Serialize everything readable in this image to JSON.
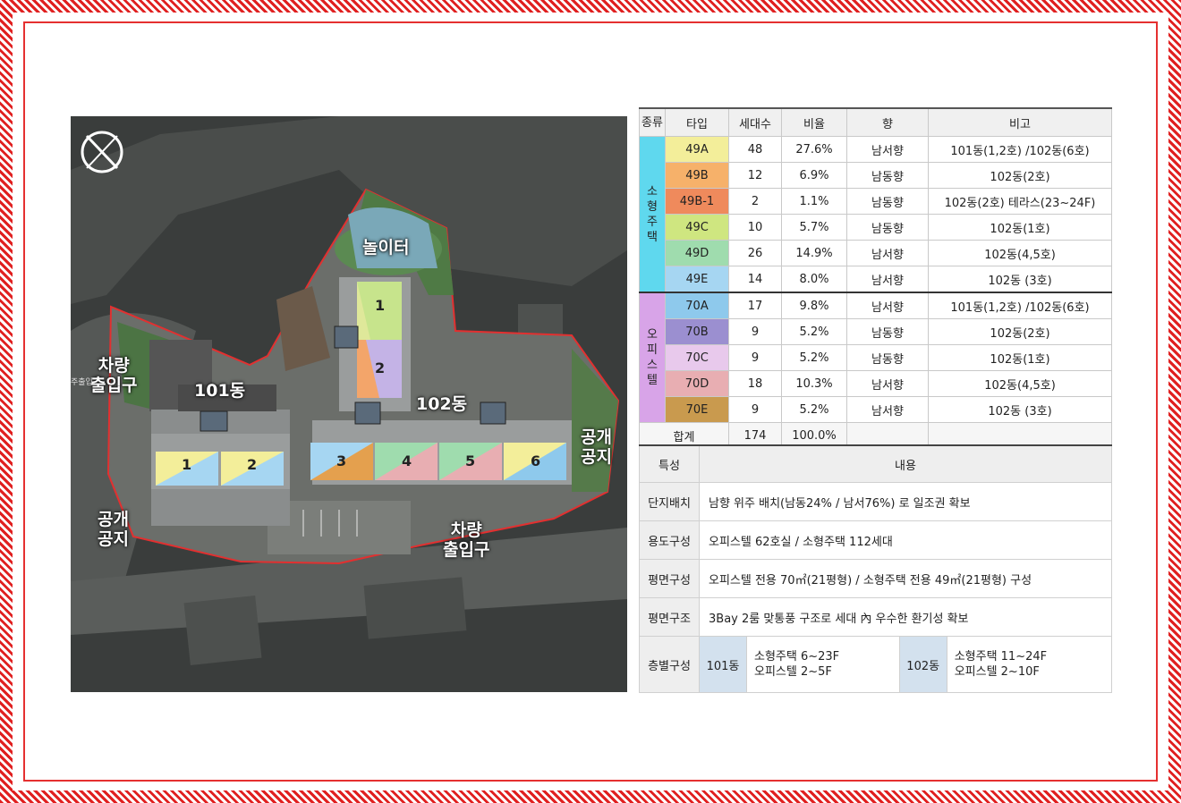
{
  "plan": {
    "labels": {
      "playground": "놀이터",
      "bldg101": "101동",
      "bldg102": "102동",
      "car_entrance_left": "차량\n출입구",
      "car_entrance_bottom": "차량\n출입구",
      "open_space_right": "공개\n공지",
      "open_space_left": "공개\n공지",
      "entrance_small": "주출입"
    },
    "units_101": [
      "1",
      "2"
    ],
    "units_102": [
      "1",
      "2",
      "3",
      "4",
      "5",
      "6"
    ]
  },
  "type_table": {
    "headers": [
      "종류",
      "타입",
      "세대수",
      "비율",
      "향",
      "비고"
    ],
    "group_small": "소\n형\n주\n택",
    "group_office": "오\n피\n스\n텔",
    "rows": [
      {
        "type": "49A",
        "count": "48",
        "ratio": "27.6%",
        "dir": "남서향",
        "note": "101동(1,2호) /102동(6호)",
        "color": "#f3ee9a"
      },
      {
        "type": "49B",
        "count": "12",
        "ratio": "6.9%",
        "dir": "남동향",
        "note": "102동(2호)",
        "color": "#f6b16a"
      },
      {
        "type": "49B-1",
        "count": "2",
        "ratio": "1.1%",
        "dir": "남동향",
        "note": "102동(2호) 테라스(23~24F)",
        "color": "#ef8a5c"
      },
      {
        "type": "49C",
        "count": "10",
        "ratio": "5.7%",
        "dir": "남동향",
        "note": "102동(1호)",
        "color": "#cfe680"
      },
      {
        "type": "49D",
        "count": "26",
        "ratio": "14.9%",
        "dir": "남서향",
        "note": "102동(4,5호)",
        "color": "#9fdcae"
      },
      {
        "type": "49E",
        "count": "14",
        "ratio": "8.0%",
        "dir": "남서향",
        "note": "102동 (3호)",
        "color": "#a6d6f2"
      },
      {
        "type": "70A",
        "count": "17",
        "ratio": "9.8%",
        "dir": "남서향",
        "note": "101동(1,2호) /102동(6호)",
        "color": "#8ec9ec"
      },
      {
        "type": "70B",
        "count": "9",
        "ratio": "5.2%",
        "dir": "남동향",
        "note": "102동(2호)",
        "color": "#9b8fd0"
      },
      {
        "type": "70C",
        "count": "9",
        "ratio": "5.2%",
        "dir": "남동향",
        "note": "102동(1호)",
        "color": "#e8c9ec"
      },
      {
        "type": "70D",
        "count": "18",
        "ratio": "10.3%",
        "dir": "남서향",
        "note": "102동(4,5호)",
        "color": "#e8aeb2"
      },
      {
        "type": "70E",
        "count": "9",
        "ratio": "5.2%",
        "dir": "남서향",
        "note": "102동 (3호)",
        "color": "#c99a4e"
      }
    ],
    "total": {
      "label": "합계",
      "count": "174",
      "ratio": "100.0%"
    },
    "group_colors": {
      "small": "#5fd8ee",
      "office": "#d8a4e8"
    }
  },
  "feature_table": {
    "headers": [
      "특성",
      "내용"
    ],
    "rows": [
      {
        "k": "단지배치",
        "v": "남향 위주 배치(남동24% /  남서76%) 로 일조권 확보"
      },
      {
        "k": "용도구성",
        "v": "오피스텔 62호실 / 소형주택 112세대"
      },
      {
        "k": "평면구성",
        "v": "오피스텔 전용 70㎡(21평형) / 소형주택 전용 49㎡(21평형) 구성"
      },
      {
        "k": "평면구조",
        "v": "3Bay 2룸 맞통풍 구조로 세대 內 우수한 환기성 확보"
      }
    ],
    "floors": {
      "k": "층별구성",
      "b1": "101동",
      "b1_l1": "소형주택 6~23F",
      "b1_l2": "오피스텔 2~5F",
      "b2": "102동",
      "b2_l1": "소형주택 11~24F",
      "b2_l2": "오피스텔 2~10F"
    }
  }
}
